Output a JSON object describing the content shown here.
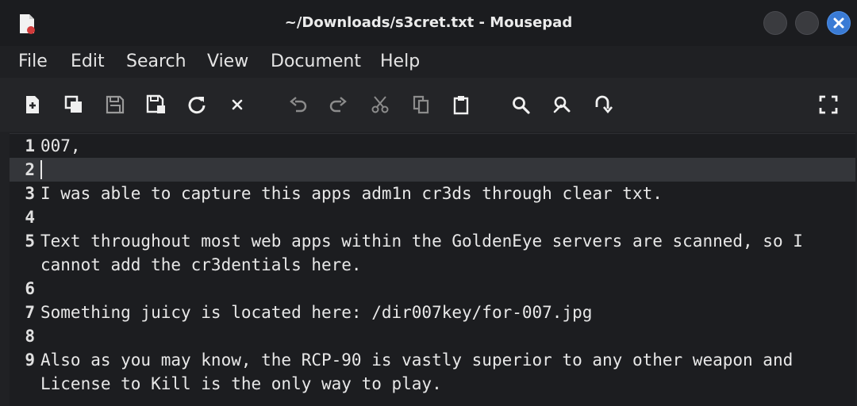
{
  "window": {
    "title": "~/Downloads/s3cret.txt - Mousepad",
    "app_icon": "text-editor-icon",
    "close_color": "#3a7bd5"
  },
  "menubar": {
    "items": [
      "File",
      "Edit",
      "Search",
      "View",
      "Document",
      "Help"
    ]
  },
  "toolbar": {
    "icons": [
      "new-document-icon",
      "new-window-icon",
      "save-icon",
      "save-as-icon",
      "reload-icon",
      "close-document-icon",
      "undo-icon",
      "redo-icon",
      "cut-icon",
      "copy-icon",
      "paste-icon",
      "find-icon",
      "find-replace-icon",
      "go-to-line-icon",
      "fullscreen-icon"
    ]
  },
  "editor": {
    "lines": [
      {
        "n": "1",
        "rows": [
          "007,"
        ]
      },
      {
        "n": "2",
        "rows": [
          ""
        ],
        "current": true
      },
      {
        "n": "3",
        "rows": [
          "I was able to capture this apps adm1n cr3ds through clear txt."
        ]
      },
      {
        "n": "4",
        "rows": [
          ""
        ]
      },
      {
        "n": "5",
        "rows": [
          "Text throughout most web apps within the GoldenEye servers are scanned, so I",
          "cannot add the cr3dentials here."
        ]
      },
      {
        "n": "6",
        "rows": [
          ""
        ]
      },
      {
        "n": "7",
        "rows": [
          "Something juicy is located here: /dir007key/for-007.jpg"
        ]
      },
      {
        "n": "8",
        "rows": [
          ""
        ]
      },
      {
        "n": "9",
        "rows": [
          "Also as you may know, the RCP-90 is vastly superior to any other weapon and",
          "License to Kill is the only way to play."
        ]
      }
    ]
  }
}
